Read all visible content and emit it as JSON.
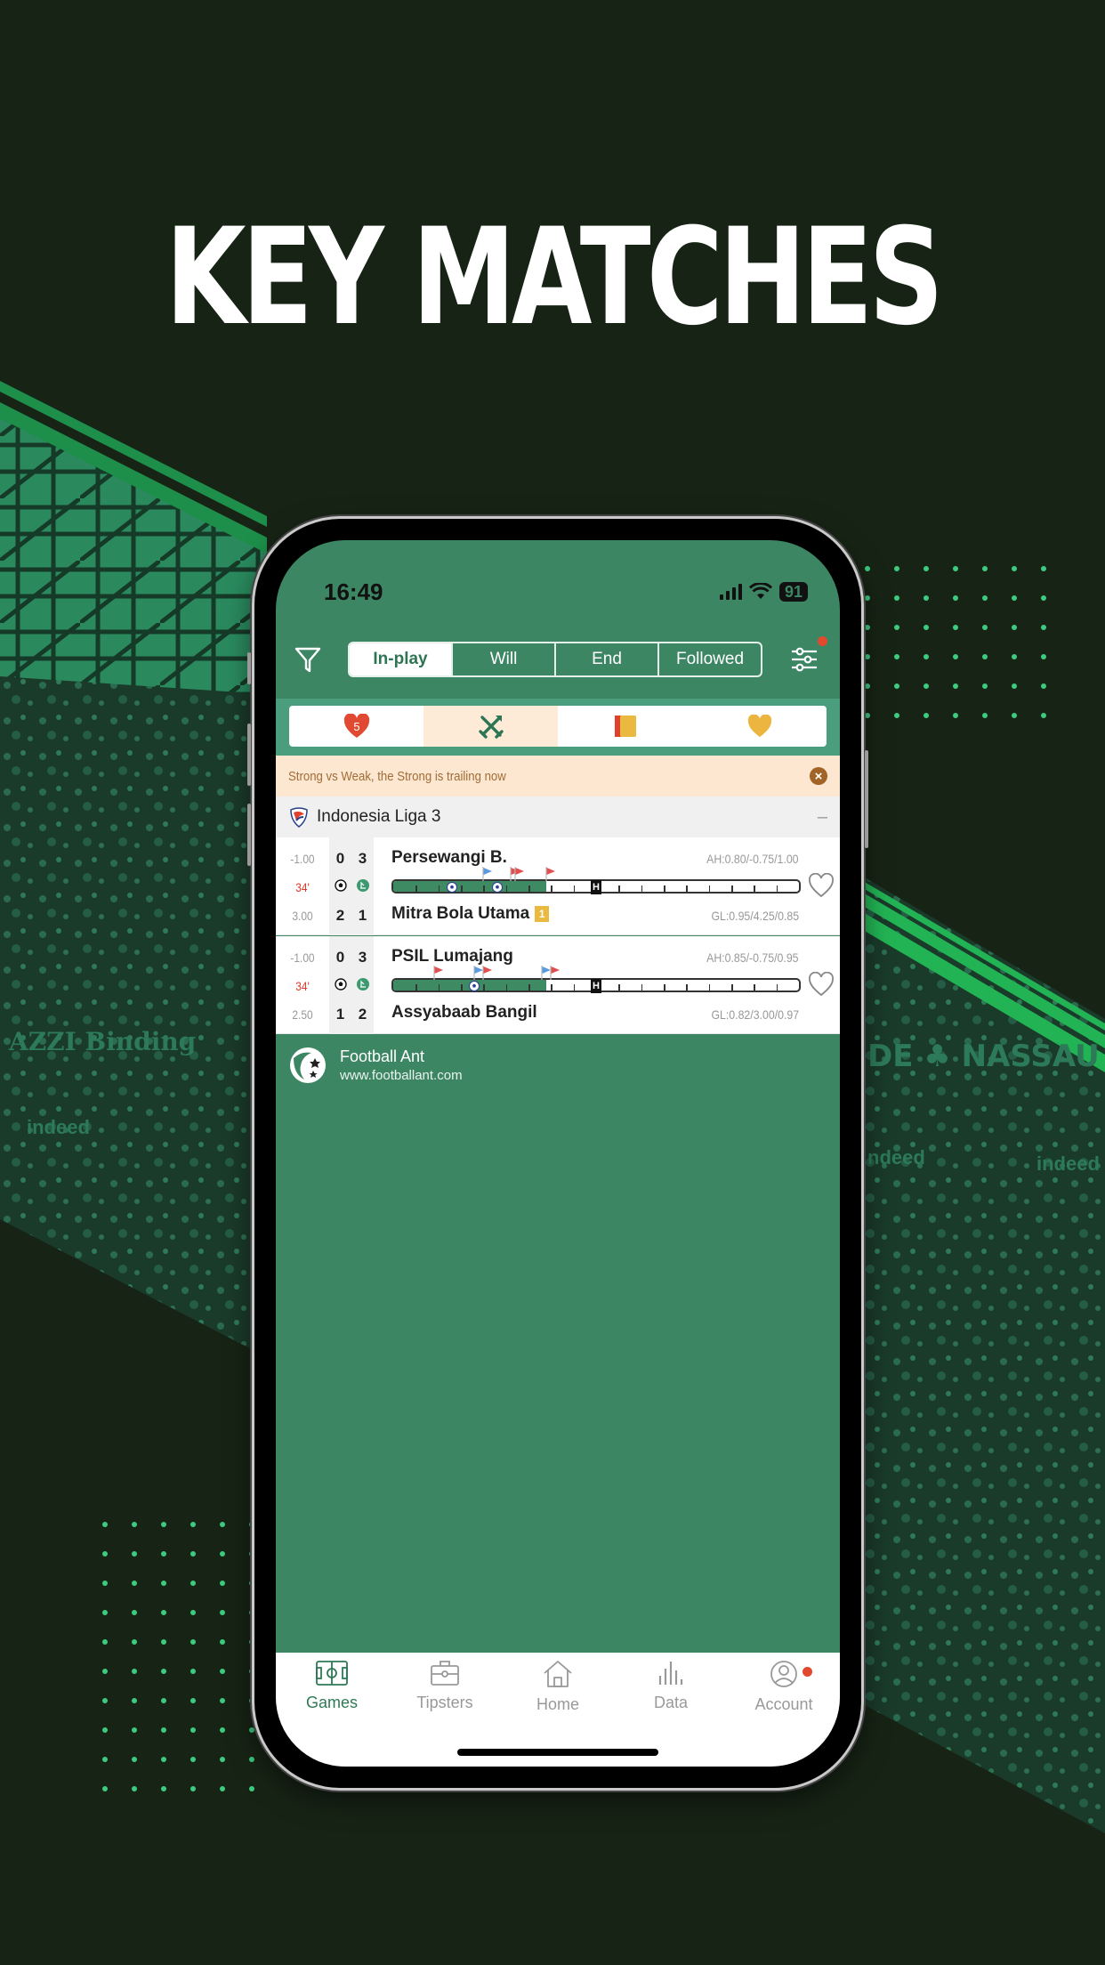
{
  "headline": "KEY MATCHES",
  "status_bar": {
    "time": "16:49",
    "battery": "91"
  },
  "top_tabs": [
    {
      "label": "In-play",
      "active": true
    },
    {
      "label": "Will",
      "active": false
    },
    {
      "label": "End",
      "active": false
    },
    {
      "label": "Followed",
      "active": false
    }
  ],
  "category_filters": [
    {
      "icon": "heart-number-icon",
      "badge": "5",
      "active": false
    },
    {
      "icon": "crossed-swords-icon",
      "active": true
    },
    {
      "icon": "card-icon",
      "active": false
    },
    {
      "icon": "heart-icon",
      "active": false
    }
  ],
  "alert": {
    "text": "Strong vs Weak, the Strong is trailing now"
  },
  "league": {
    "name": "Indonesia Liga 3",
    "collapse_symbol": "–"
  },
  "matches": [
    {
      "home": "Persewangi B.",
      "away": "Mitra Bola Utama",
      "away_yellow_cards": "1",
      "handicap": "-1.00",
      "minute": "34'",
      "total": "3.00",
      "home_half": "0",
      "home_corners": "3",
      "away_half": "2",
      "away_corners": "1",
      "ah_odds": "AH:0.80/-0.75/1.00",
      "gl_odds": "GL:0.95/4.25/0.85",
      "progress_fraction": 0.378,
      "events": [
        {
          "type": "goal",
          "minute": 13
        },
        {
          "type": "goal",
          "minute": 23
        },
        {
          "type": "corner-home",
          "minute": 20
        },
        {
          "type": "corner-away",
          "minute": 26
        },
        {
          "type": "corner-away",
          "minute": 27
        },
        {
          "type": "corner-away",
          "minute": 34
        }
      ]
    },
    {
      "home": "PSIL Lumajang",
      "away": "Assyabaab Bangil",
      "handicap": "-1.00",
      "minute": "34'",
      "total": "2.50",
      "home_half": "0",
      "home_corners": "3",
      "away_half": "1",
      "away_corners": "2",
      "ah_odds": "AH:0.85/-0.75/0.95",
      "gl_odds": "GL:0.82/3.00/0.97",
      "progress_fraction": 0.378,
      "events": [
        {
          "type": "goal",
          "minute": 18
        },
        {
          "type": "corner-away",
          "minute": 9
        },
        {
          "type": "corner-home",
          "minute": 18
        },
        {
          "type": "corner-away",
          "minute": 20
        },
        {
          "type": "corner-home",
          "minute": 33
        },
        {
          "type": "corner-away",
          "minute": 35
        }
      ]
    }
  ],
  "timeline_half_label": "H",
  "footer_brand": {
    "name": "Football Ant",
    "url": "www.footballant.com"
  },
  "bottom_nav": [
    {
      "label": "Games",
      "icon": "pitch-icon",
      "active": true
    },
    {
      "label": "Tipsters",
      "icon": "briefcase-icon",
      "active": false
    },
    {
      "label": "Home",
      "icon": "house-icon",
      "active": false
    },
    {
      "label": "Data",
      "icon": "bar-chart-icon",
      "active": false
    },
    {
      "label": "Account",
      "icon": "user-icon",
      "active": false,
      "notification": true
    }
  ],
  "colors": {
    "brand_green": "#3c8664",
    "active_green": "#2e7a57",
    "alert_bg": "#fde7d0",
    "alert_text": "#a06c37",
    "notification_red": "#e24a2f",
    "live_minute": "#e03a2a"
  }
}
